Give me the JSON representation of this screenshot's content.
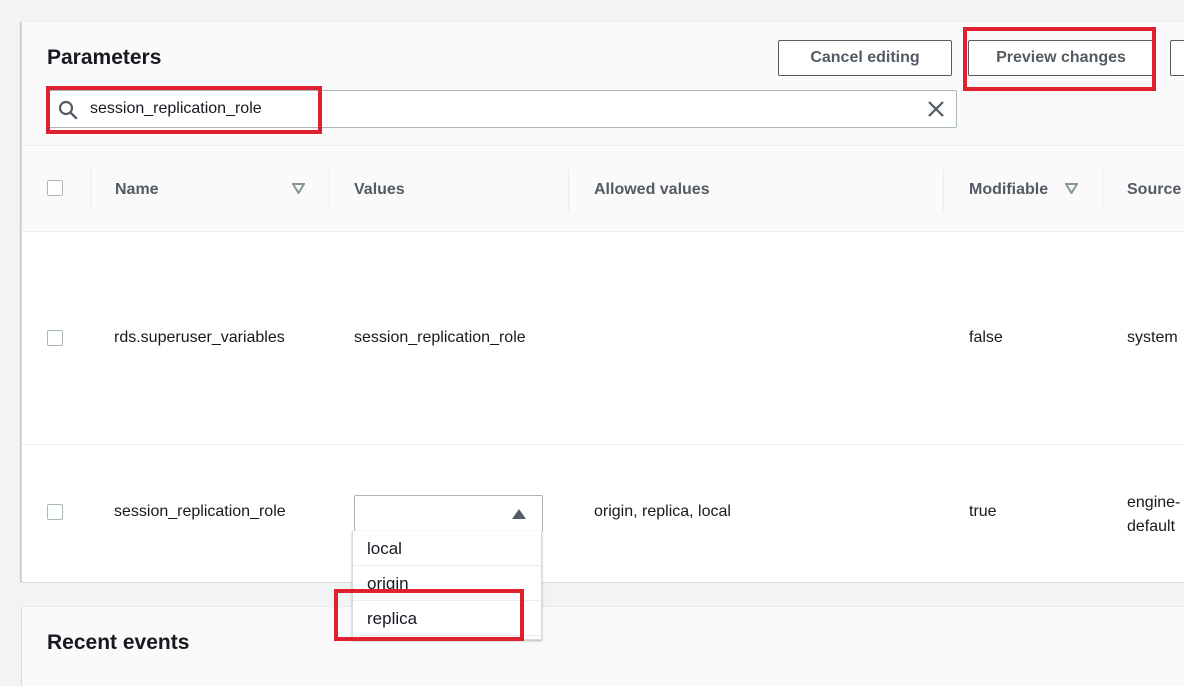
{
  "parameters_panel": {
    "title": "Parameters",
    "buttons": {
      "cancel_editing": "Cancel editing",
      "preview_changes": "Preview changes"
    },
    "search": {
      "value": "session_replication_role",
      "icon": "search-icon",
      "clear_icon": "close-icon"
    },
    "table": {
      "columns": [
        {
          "label": "Name",
          "sortable": true
        },
        {
          "label": "Values",
          "sortable": false
        },
        {
          "label": "Allowed values",
          "sortable": false
        },
        {
          "label": "Modifiable",
          "sortable": true
        },
        {
          "label": "Source",
          "sortable": false
        }
      ],
      "rows": [
        {
          "name": "rds.superuser_variables",
          "values": "session_replication_role",
          "allowed_values": "",
          "modifiable": "false",
          "source": "system"
        },
        {
          "name": "session_replication_role",
          "values": "",
          "allowed_values": "origin, replica, local",
          "modifiable": "true",
          "source_line1": "engine-",
          "source_line2": "default"
        }
      ]
    },
    "dropdown": {
      "options": [
        "local",
        "origin",
        "replica"
      ],
      "highlighted": "replica"
    }
  },
  "recent_events_panel": {
    "title": "Recent events"
  },
  "annotation_color": "#e0202f"
}
